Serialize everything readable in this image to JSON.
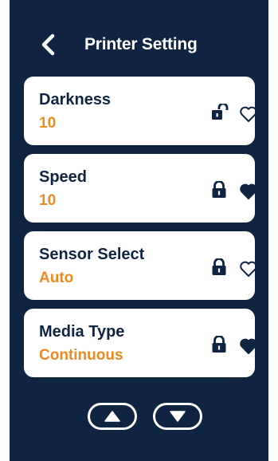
{
  "header": {
    "title": "Printer Setting",
    "back_icon": "chevron-left-icon"
  },
  "settings": [
    {
      "label": "Darkness",
      "value": "10",
      "locked": false,
      "favorite": false
    },
    {
      "label": "Speed",
      "value": "10",
      "locked": true,
      "favorite": true
    },
    {
      "label": "Sensor Select",
      "value": "Auto",
      "locked": true,
      "favorite": false
    },
    {
      "label": "Media Type",
      "value": "Continuous",
      "locked": true,
      "favorite": true
    }
  ],
  "navigation": {
    "up_icon": "triangle-up-icon",
    "down_icon": "triangle-down-icon"
  },
  "colors": {
    "background": "#0f2440",
    "card": "#ffffff",
    "value_accent": "#ee8a1f",
    "text": "#0f2440"
  }
}
